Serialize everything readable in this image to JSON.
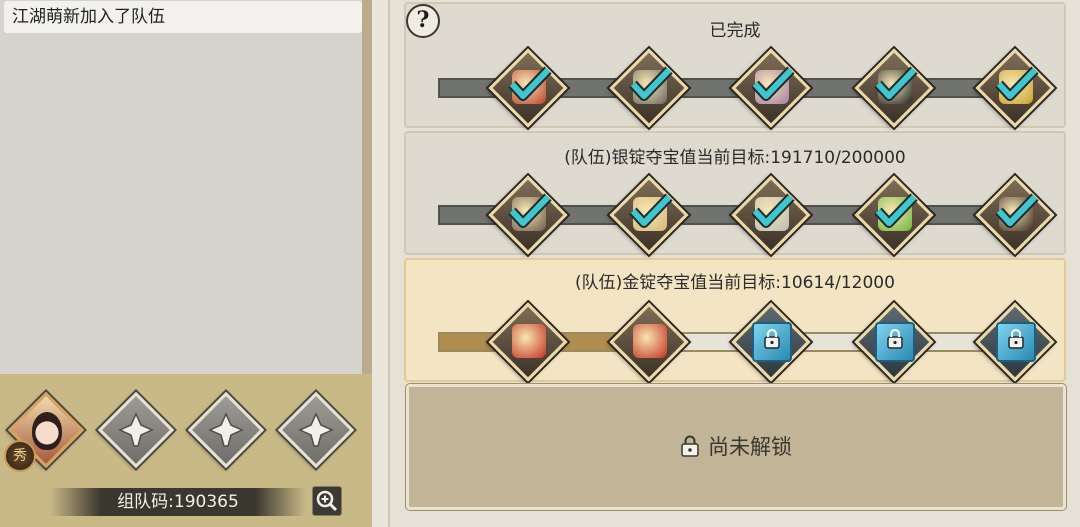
{
  "chat": {
    "message": "江湖萌新加入了队伍"
  },
  "team": {
    "avatar_badge": "秀",
    "team_code_label": "组队码:190365",
    "empty_slots": [
      "empty-slot-1",
      "empty-slot-2",
      "empty-slot-3"
    ]
  },
  "rows": [
    {
      "id": "row-completed",
      "title": "已完成",
      "progress": 1.0,
      "rewards": [
        {
          "name": "gift-chest",
          "color": "#b7422c",
          "status": "claimed"
        },
        {
          "name": "stone-pouch",
          "color": "#6b6660",
          "status": "claimed"
        },
        {
          "name": "scroll-bundle",
          "color": "#a57ba8",
          "status": "claimed"
        },
        {
          "name": "mystery-box",
          "color": "#1e2426",
          "status": "claimed"
        },
        {
          "name": "herb-basket",
          "color": "#c8a12a",
          "status": "claimed"
        }
      ]
    },
    {
      "id": "row-silver",
      "title": "(队伍)银锭夺宝值当前目标:191710/200000",
      "current": 191710,
      "target": 200000,
      "rewards": [
        {
          "name": "pickaxe",
          "color": "#6b5b4b",
          "status": "claimed"
        },
        {
          "name": "map-scroll",
          "color": "#d7b776",
          "status": "claimed"
        },
        {
          "name": "silver-ingot",
          "color": "#b9bbb6",
          "status": "claimed"
        },
        {
          "name": "clover",
          "color": "#6fb53a",
          "status": "claimed"
        },
        {
          "name": "wine-jar",
          "color": "#3a2a20",
          "status": "claimed"
        }
      ]
    },
    {
      "id": "row-gold",
      "title": "(队伍)金锭夺宝值当前目标:10614/12000",
      "current": 10614,
      "target": 12000,
      "rewards": [
        {
          "name": "gold-chest",
          "color": "#c4301f",
          "status": "unlocked"
        },
        {
          "name": "gold-chest",
          "color": "#c4301f",
          "status": "unlocked"
        },
        {
          "name": "blue-chest",
          "color": "#45b4dc",
          "status": "locked"
        },
        {
          "name": "blue-chest",
          "color": "#45b4dc",
          "status": "locked"
        },
        {
          "name": "blue-chest",
          "color": "#45b4dc",
          "status": "locked"
        }
      ]
    }
  ],
  "locked_tier": {
    "label": "尚未解锁"
  },
  "icons": {
    "help": "?",
    "search": "zoom-in-icon",
    "check": "check-icon",
    "lock": "lock-icon"
  }
}
